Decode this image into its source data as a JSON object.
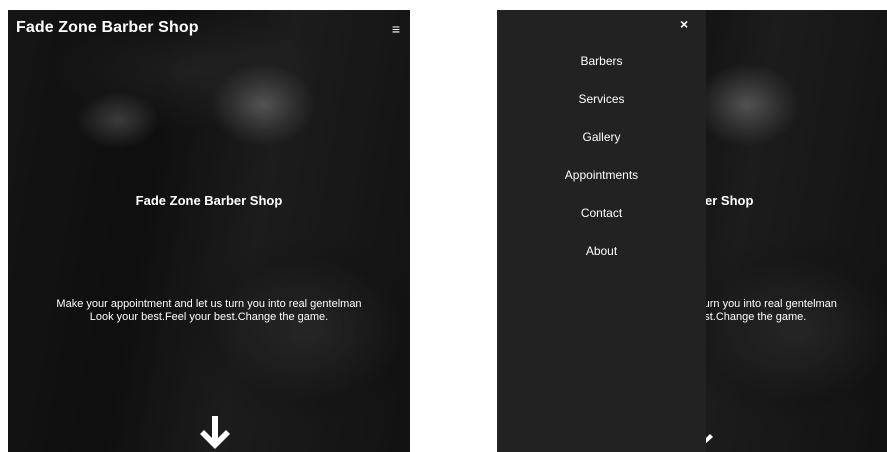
{
  "left_view": {
    "brand": "Fade Zone Barber Shop",
    "menu_icon": "≡",
    "hero": {
      "title": "Fade Zone Barber Shop",
      "subtitle_line1": "Make your appointment and let us turn you into real gentelman",
      "subtitle_line2": "Look your best.Feel your best.Change the game."
    },
    "scroll_icon": "arrow-down-icon"
  },
  "right_view": {
    "close_icon": "×",
    "nav_items": [
      {
        "label": "Barbers"
      },
      {
        "label": "Services"
      },
      {
        "label": "Gallery"
      },
      {
        "label": "Appointments"
      },
      {
        "label": "Contact"
      },
      {
        "label": "About"
      }
    ],
    "hero_visible": {
      "title": "rber Shop",
      "subtitle_line1": "s turn you into real gentelman",
      "subtitle_line2": "best.Change the game."
    }
  },
  "colors": {
    "sidenav_bg": "#222222",
    "text": "#ffffff",
    "page_bg": "#ffffff"
  }
}
